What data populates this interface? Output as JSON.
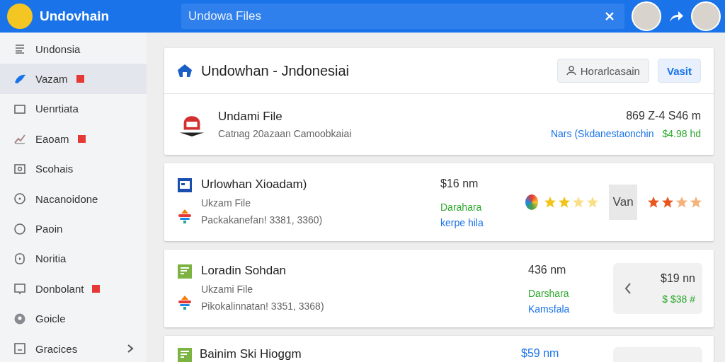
{
  "top_bar": {
    "brand": "Undovhain",
    "search": {
      "value": "Undowa Files"
    }
  },
  "sidebar": {
    "items": [
      {
        "label": "Undonsia",
        "selected": false,
        "badge": false,
        "expandable": false
      },
      {
        "label": "Vazam",
        "selected": true,
        "badge": true,
        "expandable": false
      },
      {
        "label": "Uenrtiata",
        "selected": false,
        "badge": false,
        "expandable": false
      },
      {
        "label": "Eaoam",
        "selected": false,
        "badge": true,
        "expandable": false
      },
      {
        "label": "Scohais",
        "selected": false,
        "badge": false,
        "expandable": false
      },
      {
        "label": "Nacanoidone",
        "selected": false,
        "badge": false,
        "expandable": false
      },
      {
        "label": "Paoin",
        "selected": false,
        "badge": false,
        "expandable": false
      },
      {
        "label": "Noritia",
        "selected": false,
        "badge": false,
        "expandable": false
      },
      {
        "label": "Donbolant",
        "selected": false,
        "badge": true,
        "expandable": false
      },
      {
        "label": "Goicle",
        "selected": false,
        "badge": false,
        "expandable": false
      },
      {
        "label": "Gracices",
        "selected": false,
        "badge": false,
        "expandable": true
      }
    ]
  },
  "header": {
    "title": "Undowhan - Jndonesiai",
    "buttons": [
      {
        "label": "Horarlcasain",
        "kind": "secondary"
      },
      {
        "label": "Vasit",
        "kind": "primary"
      }
    ],
    "file": {
      "title": "Undami File",
      "subtitle": "Catnag 20azaan Camoobkaiai",
      "size": "869 Z-4 S46 m",
      "link": "Nars (Skdanestaonchin",
      "price": "$4.98 hd"
    }
  },
  "files": [
    {
      "kind": "rating",
      "title": "Urlowhan Xioadam)",
      "type": "Ukzam File",
      "detail": "Packakanefan! 3381, 3360)",
      "size": "$16 nm",
      "status": "Darahara",
      "link": "kerpe hila",
      "ratings": [
        {
          "stars": 2
        },
        {
          "stars": 2
        }
      ],
      "tag": "Van"
    },
    {
      "kind": "price",
      "title": "Loradin Sohdan",
      "type": "Ukzami File",
      "detail": "Pikokalinnatan! 3351, 3368)",
      "size": "436 nm",
      "status": "Darshara",
      "link": "Kamsfala",
      "price": "$19 nn",
      "price_b": "$ $38 #"
    },
    {
      "kind": "partial",
      "title": "Bainim Ski Hioggm",
      "size": "$59 nm"
    }
  ]
}
